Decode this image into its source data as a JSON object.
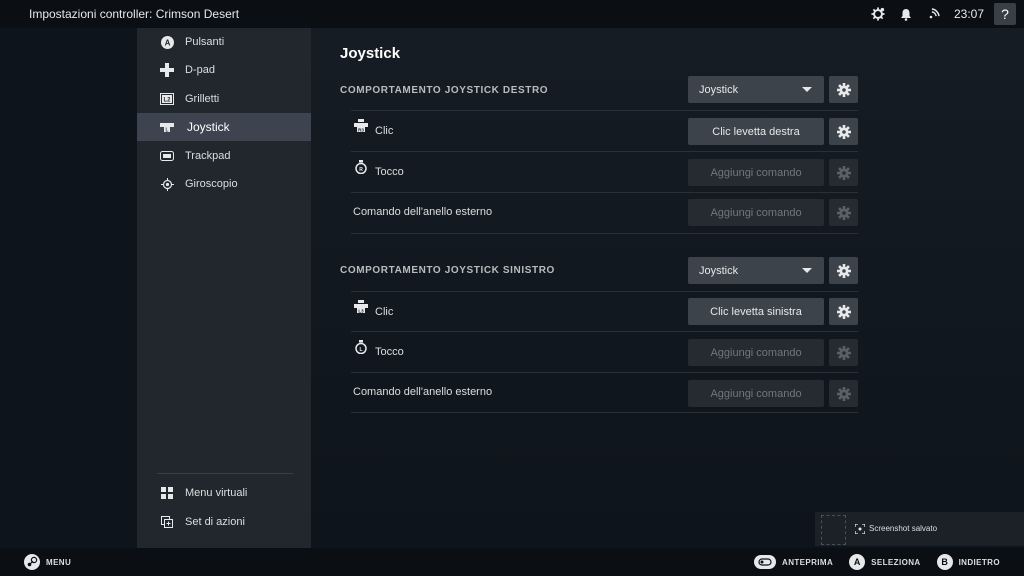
{
  "topbar": {
    "title": "Impostazioni controller: Crimson Desert",
    "clock": "23:07",
    "help": "?"
  },
  "sidebar": {
    "items": [
      {
        "label": "Pulsanti",
        "icon": "a-button-icon"
      },
      {
        "label": "D-pad",
        "icon": "dpad-icon"
      },
      {
        "label": "Grilletti",
        "icon": "trigger-l2-icon"
      },
      {
        "label": "Joystick",
        "icon": "joystick-icon",
        "active": true
      },
      {
        "label": "Trackpad",
        "icon": "trackpad-icon"
      },
      {
        "label": "Giroscopio",
        "icon": "gyro-icon"
      }
    ],
    "bottom_items": [
      {
        "label": "Menu virtuali",
        "icon": "grid-icon"
      },
      {
        "label": "Set di azioni",
        "icon": "action-set-icon"
      }
    ]
  },
  "main": {
    "heading": "Joystick",
    "sections": [
      {
        "title": "COMPORTAMENTO JOYSTICK DESTRO",
        "mode": "Joystick",
        "rows": [
          {
            "label": "Clic",
            "command": "Clic levetta destra",
            "enabled": true
          },
          {
            "label": "Tocco",
            "command": "Aggiungi comando",
            "enabled": false
          },
          {
            "label": "Comando dell'anello esterno",
            "command": "Aggiungi comando",
            "enabled": false
          }
        ]
      },
      {
        "title": "COMPORTAMENTO JOYSTICK SINISTRO",
        "mode": "Joystick",
        "rows": [
          {
            "label": "Clic",
            "command": "Clic levetta sinistra",
            "enabled": true
          },
          {
            "label": "Tocco",
            "command": "Aggiungi comando",
            "enabled": false
          },
          {
            "label": "Comando dell'anello esterno",
            "command": "Aggiungi comando",
            "enabled": false
          }
        ]
      }
    ]
  },
  "toast": {
    "text": "Screenshot salvato"
  },
  "bottombar": {
    "menu": "MENU",
    "preview": "ANTEPRIMA",
    "select_key": "A",
    "select": "SELEZIONA",
    "back_key": "B",
    "back": "INDIETRO"
  },
  "colors": {
    "background": "#0e141b",
    "sidebar": "#22272e",
    "active_item": "#3d4450",
    "button": "#3d434b",
    "button_disabled": "#262b32"
  }
}
